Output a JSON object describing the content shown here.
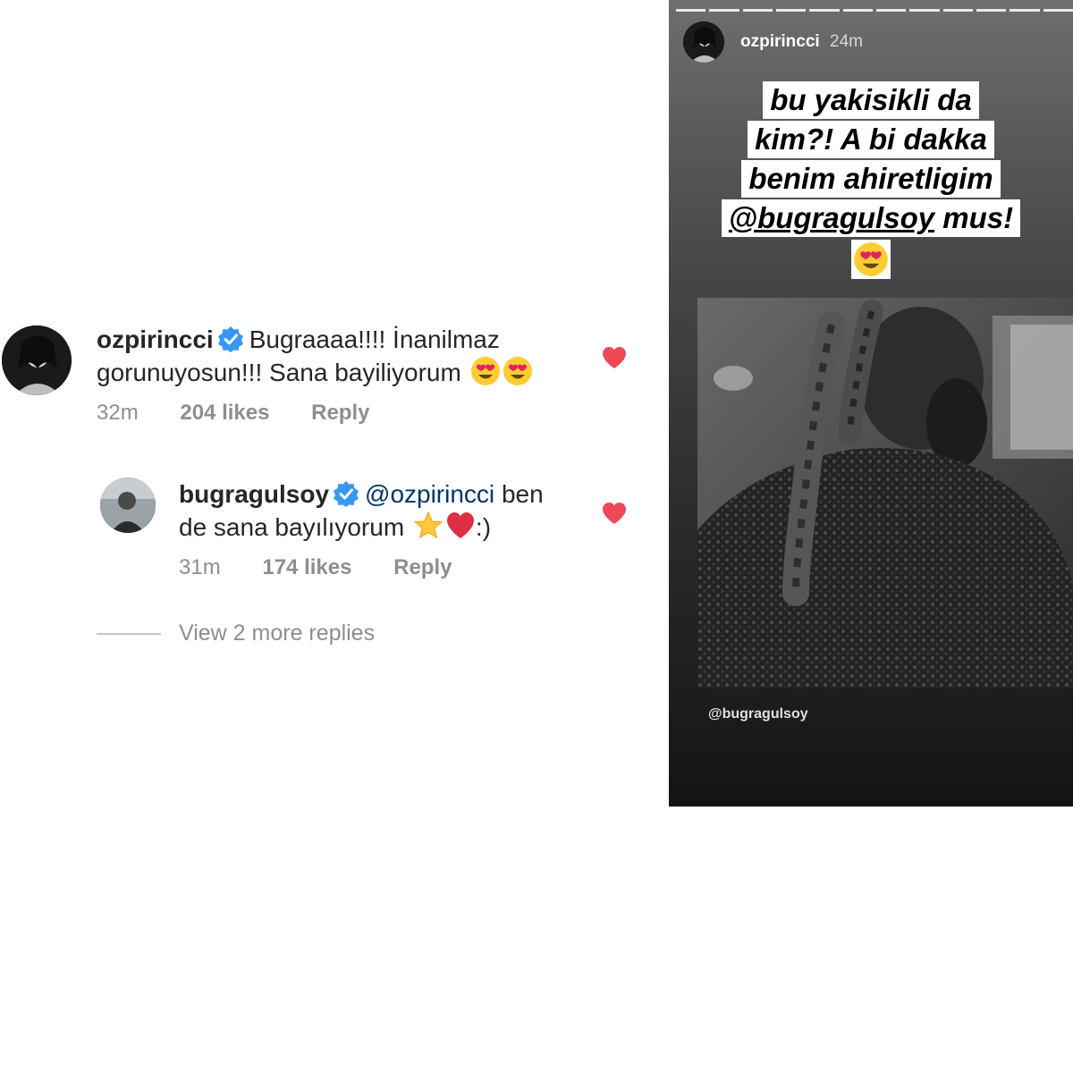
{
  "comments": [
    {
      "username": "ozpirincci",
      "text_line1": "Bugraaaa!!!! İnanilmaz",
      "text_line2": "gorunuyosun!!! Sana bayiliyorum",
      "emojis": [
        "heart-eyes",
        "heart-eyes"
      ],
      "time": "32m",
      "likes": "204 likes",
      "reply": "Reply",
      "liked": true
    },
    {
      "username": "bugragulsoy",
      "mention": "@ozpirincci",
      "text_after_mention": "ben",
      "text_line2": "de sana bayılıyorum",
      "text_end": ":)",
      "emojis": [
        "star",
        "red-heart"
      ],
      "time": "31m",
      "likes": "174 likes",
      "reply": "Reply",
      "liked": true
    }
  ],
  "view_more": "View 2 more replies",
  "story": {
    "username": "ozpirincci",
    "time": "24m",
    "progress_segments": 12,
    "caption_lines": [
      "bu yakisikli da",
      "kim?! A bi dakka",
      "benim ahiretligim"
    ],
    "caption_mention": "@bugragulsoy",
    "caption_mention_after": " mus!",
    "caption_emoji": "heart-eyes",
    "photo_tag": "@bugragulsoy"
  },
  "colors": {
    "heart": "#ed4956",
    "verified": "#3897f0",
    "mention": "#003569",
    "meta": "#8e8e8e"
  }
}
